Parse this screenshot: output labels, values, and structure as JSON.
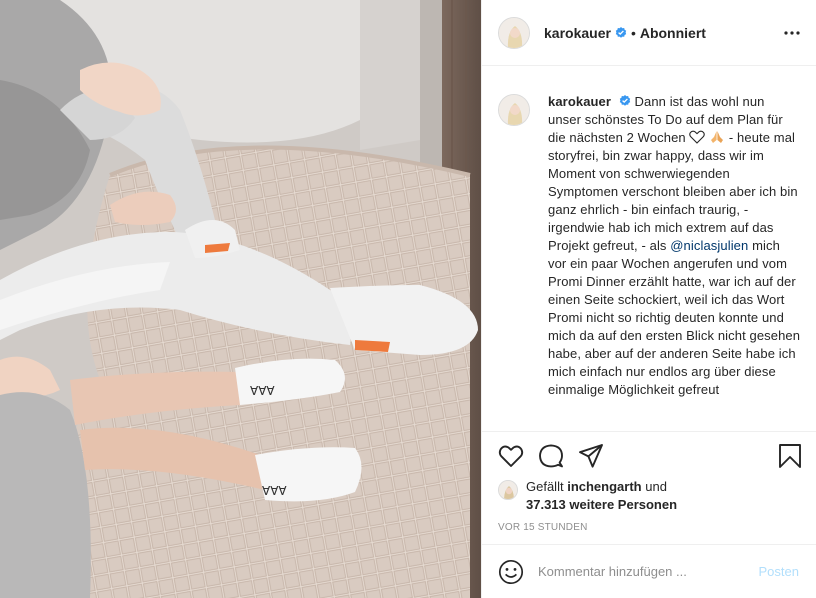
{
  "post": {
    "author": "karokauer",
    "follow_status": "Abonniert",
    "separator": "•",
    "caption_text": "Dann ist das wohl nun unser schönstes To Do auf dem Plan für die nächsten 2 Wochen",
    "caption_text_2": " - heute mal storyfrei, bin zwar happy, dass wir im Moment von schwerwiegenden Symptomen verschont bleiben aber ich bin ganz ehrlich - bin einfach traurig, - irgendwie hab ich mich extrem auf das Projekt gefreut, - als ",
    "mention": "@niclasjulien",
    "caption_text_3": " mich vor ein paar Wochen angerufen und vom Promi Dinner erzählt hatte, war ich auf der einen Seite schockiert, weil ich das Wort Promi nicht so richtig deuten konnte und mich da auf den ersten Blick nicht gesehen habe, aber auf der anderen Seite habe ich mich einfach nur endlos arg über diese einmalige Möglichkeit gefreut",
    "liked_by_prefix": "Gefällt",
    "liked_by_user": "inchengarth",
    "liked_by_and": "und",
    "liked_by_count": "37.313 weitere Personen",
    "timestamp": "VOR 15 STUNDEN"
  },
  "comment": {
    "placeholder": "Kommentar hinzufügen ...",
    "post_label": "Posten"
  },
  "icons": {
    "verified": "verified-badge-icon",
    "more": "more-options-icon",
    "like": "heart-icon",
    "comment": "comment-icon",
    "share": "share-icon",
    "save": "bookmark-icon",
    "emoji": "emoji-icon"
  },
  "colors": {
    "verified_blue": "#3897f0",
    "mention_blue": "#00376b",
    "post_button_disabled": "#b2dffc",
    "muted_text": "#8e8e8e"
  }
}
